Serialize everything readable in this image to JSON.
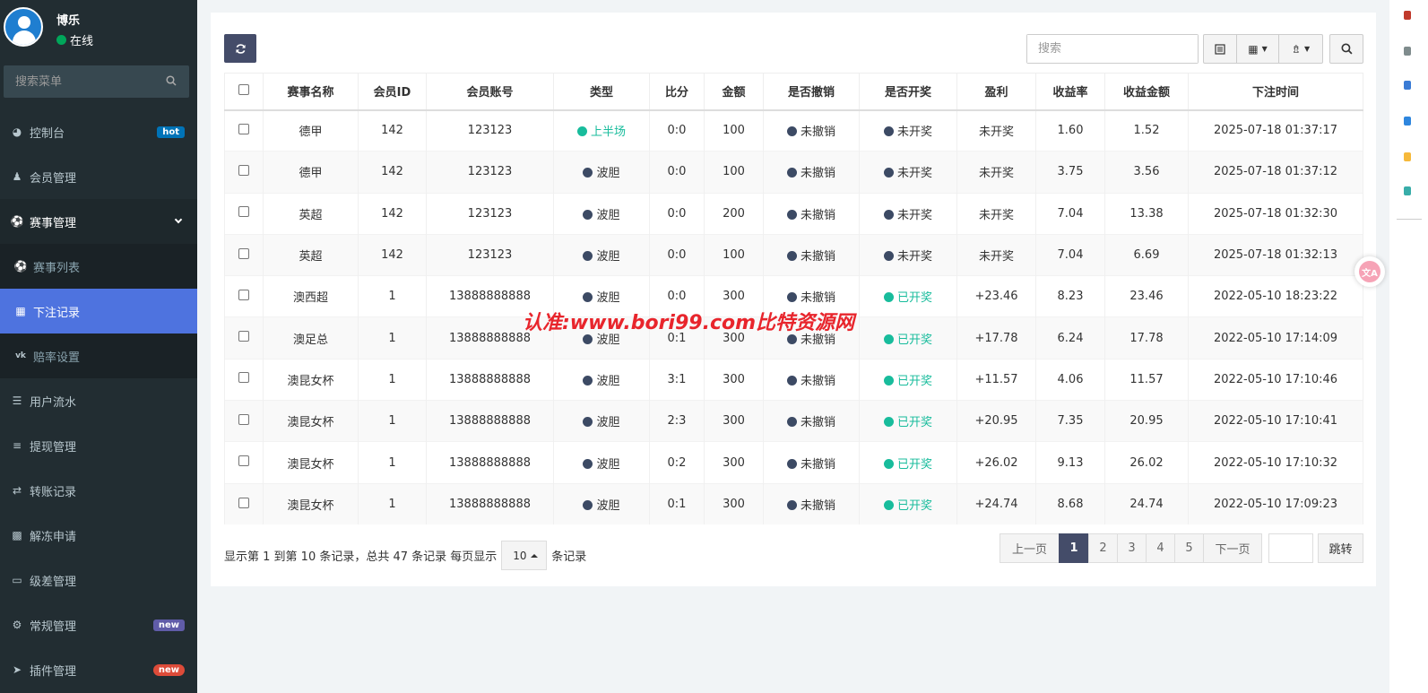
{
  "user": {
    "name": "博乐",
    "status": "在线"
  },
  "sidebar": {
    "search_placeholder": "搜索菜单",
    "items": [
      {
        "label": "控制台",
        "icon": "dashboard-icon",
        "badge": "hot"
      },
      {
        "label": "会员管理",
        "icon": "users-icon"
      },
      {
        "label": "赛事管理",
        "icon": "soccer-ball-icon"
      },
      {
        "label": "赛事列表",
        "icon": "soccer-ball-icon"
      },
      {
        "label": "下注记录",
        "icon": "calendar-icon"
      },
      {
        "label": "赔率设置",
        "icon": "vk-icon"
      },
      {
        "label": "用户流水",
        "icon": "bars-icon"
      },
      {
        "label": "提现管理",
        "icon": "list-icon"
      },
      {
        "label": "转账记录",
        "icon": "transfer-icon"
      },
      {
        "label": "解冻申请",
        "icon": "image-icon"
      },
      {
        "label": "级差管理",
        "icon": "window-icon"
      },
      {
        "label": "常规管理",
        "icon": "cogs-icon",
        "badge": "new"
      },
      {
        "label": "插件管理",
        "icon": "rocket-icon",
        "badge": "new"
      }
    ]
  },
  "toolbar": {
    "search_placeholder": "搜索"
  },
  "table": {
    "headers": [
      "赛事名称",
      "会员ID",
      "会员账号",
      "类型",
      "比分",
      "金额",
      "是否撤销",
      "是否开奖",
      "盈利",
      "收益率",
      "收益金额",
      "下注时间"
    ],
    "rows": [
      [
        "德甲",
        "142",
        "123123",
        "上半场",
        "0:0",
        "100",
        "未撤销",
        "未开奖",
        "未开奖",
        "1.60",
        "1.52",
        "2025-07-18 01:37:17"
      ],
      [
        "德甲",
        "142",
        "123123",
        "波胆",
        "0:0",
        "100",
        "未撤销",
        "未开奖",
        "未开奖",
        "3.75",
        "3.56",
        "2025-07-18 01:37:12"
      ],
      [
        "英超",
        "142",
        "123123",
        "波胆",
        "0:0",
        "200",
        "未撤销",
        "未开奖",
        "未开奖",
        "7.04",
        "13.38",
        "2025-07-18 01:32:30"
      ],
      [
        "英超",
        "142",
        "123123",
        "波胆",
        "0:0",
        "100",
        "未撤销",
        "未开奖",
        "未开奖",
        "7.04",
        "6.69",
        "2025-07-18 01:32:13"
      ],
      [
        "澳西超",
        "1",
        "13888888888",
        "波胆",
        "0:0",
        "300",
        "未撤销",
        "已开奖",
        "+23.46",
        "8.23",
        "23.46",
        "2022-05-10 18:23:22"
      ],
      [
        "澳足总",
        "1",
        "13888888888",
        "波胆",
        "0:1",
        "300",
        "未撤销",
        "已开奖",
        "+17.78",
        "6.24",
        "17.78",
        "2022-05-10 17:14:09"
      ],
      [
        "澳昆女杯",
        "1",
        "13888888888",
        "波胆",
        "3:1",
        "300",
        "未撤销",
        "已开奖",
        "+11.57",
        "4.06",
        "11.57",
        "2022-05-10 17:10:46"
      ],
      [
        "澳昆女杯",
        "1",
        "13888888888",
        "波胆",
        "2:3",
        "300",
        "未撤销",
        "已开奖",
        "+20.95",
        "7.35",
        "20.95",
        "2022-05-10 17:10:41"
      ],
      [
        "澳昆女杯",
        "1",
        "13888888888",
        "波胆",
        "0:2",
        "300",
        "未撤销",
        "已开奖",
        "+26.02",
        "9.13",
        "26.02",
        "2022-05-10 17:10:32"
      ],
      [
        "澳昆女杯",
        "1",
        "13888888888",
        "波胆",
        "0:1",
        "300",
        "未撤销",
        "已开奖",
        "+24.74",
        "8.68",
        "24.74",
        "2022-05-10 17:09:23"
      ]
    ]
  },
  "pager": {
    "info_prefix": "显示第 1 到第 10 条记录，总共 47 条记录 每页显示",
    "page_size": "10",
    "info_suffix": "条记录",
    "prev": "上一页",
    "pages": [
      "1",
      "2",
      "3",
      "4",
      "5"
    ],
    "current": "1",
    "next": "下一页",
    "goto": "跳转"
  },
  "watermark": "认准:www.bori99.com比特资源网",
  "translate_badge": "文A",
  "colors": {
    "sidebar_bg": "#222d32",
    "active": "#4e73df",
    "dark_btn": "#444c69",
    "green": "#18bc9c",
    "dot_dark": "#3c4a64"
  }
}
